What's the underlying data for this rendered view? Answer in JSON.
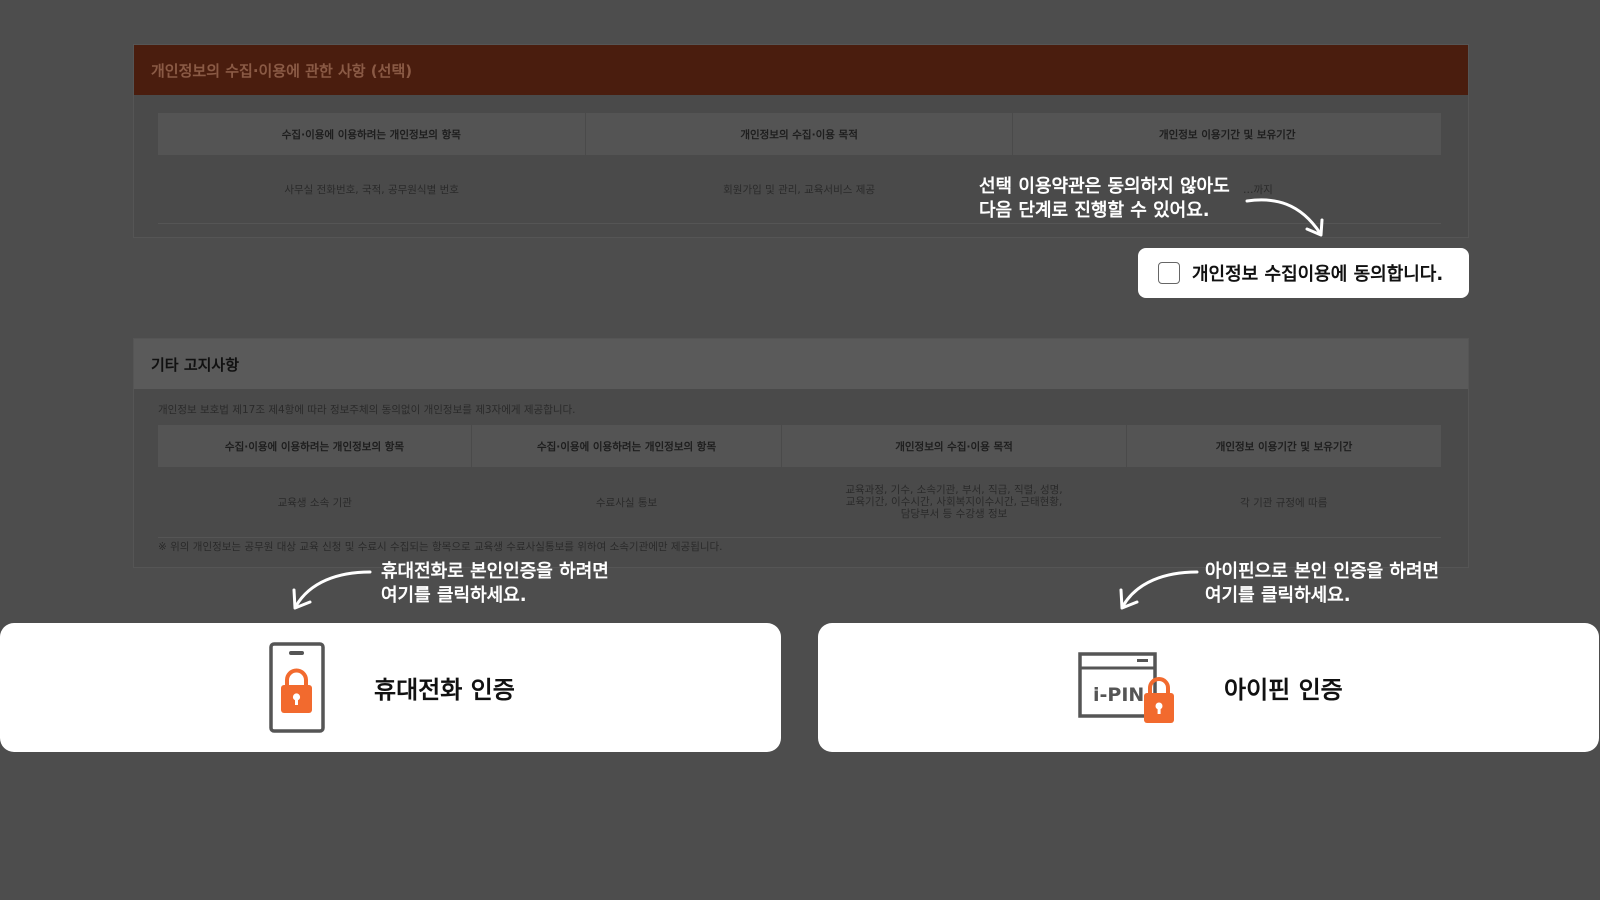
{
  "section1": {
    "title": "개인정보의 수집·이용에 관한 사항 (선택)",
    "headers": [
      "수집·이용에 이용하려는 개인정보의 항목",
      "개인정보의 수집·이용 목적",
      "개인정보 이용기간 및 보유기간"
    ],
    "row": [
      "사무실 전화번호, 국적, 공무원식별 번호",
      "회원가입 및 관리, 교육서비스 제공",
      "…까지"
    ]
  },
  "optional_callout": {
    "line1": "선택 이용약관은 동의하지 않아도",
    "line2": "다음 단계로 진행할 수 있어요."
  },
  "consent": {
    "label": "개인정보 수집이용에 동의합니다.",
    "checked": false
  },
  "section2": {
    "title": "기타 고지사항",
    "notice": "개인정보 보호법 제17조 제4항에 따라 정보주체의 동의없이 개인정보를 제3자에게 제공합니다.",
    "headers": [
      "수집·이용에 이용하려는 개인정보의 항목",
      "수집·이용에 이용하려는 개인정보의 항목",
      "개인정보의 수집·이용 목적",
      "개인정보 이용기간 및 보유기간"
    ],
    "row": [
      "교육생 소속 기관",
      "수료사실 통보",
      "교육과정, 기수, 소속기관, 부서, 직급, 직렬, 성명, 교육기간, 이수시간, 사회복지이수시간, 근태현황, 담당부서 등 수강생 정보",
      "각 기관 규정에 따름"
    ],
    "footnote": "※ 위의 개인정보는 공무원 대상 교육 신청 및 수료시 수집되는 항목으로 교육생 수료사실통보를 위하여 소속기관에만 제공됩니다."
  },
  "phone_callout": {
    "line1": "휴대전화로 본인인증을 하려면",
    "line2": "여기를 클릭하세요."
  },
  "ipin_callout": {
    "line1": "아이핀으로 본인 인증을 하려면",
    "line2": "여기를 클릭하세요."
  },
  "phone_auth": {
    "label": "휴대전화 인증",
    "icon": "phone-lock-icon"
  },
  "ipin_auth": {
    "label": "아이핀 인증",
    "icon": "ipin-lock-icon",
    "icon_text": "i-PIN"
  },
  "colors": {
    "accent": "#f26a2e",
    "overlay": "#4d4d4d",
    "card": "#ffffff"
  }
}
